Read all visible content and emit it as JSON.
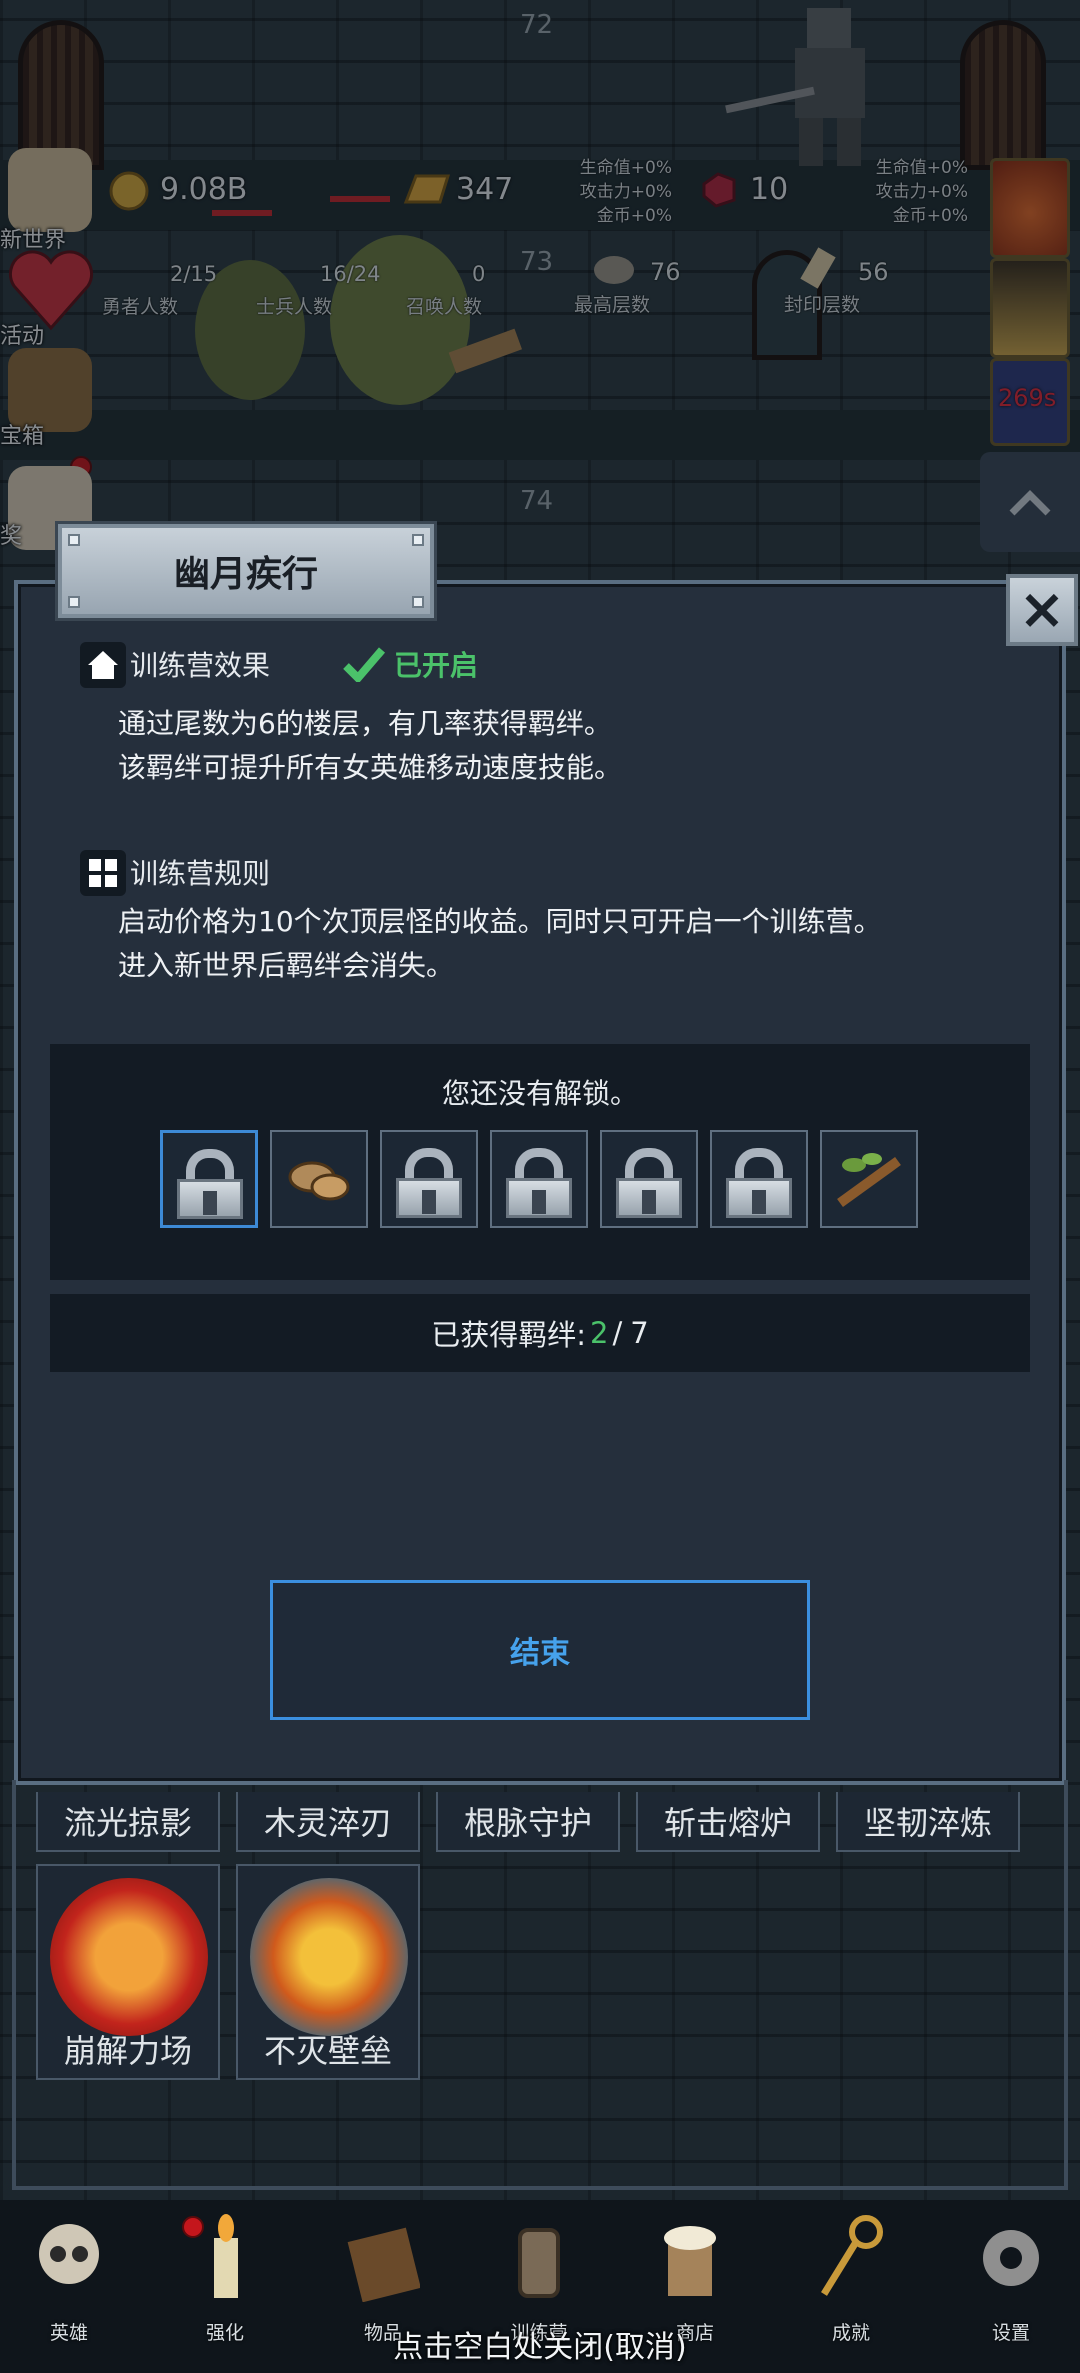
{
  "floors": [
    "72",
    "73",
    "74"
  ],
  "resources": {
    "gold": "9.08B",
    "bars": "347",
    "gems": "10",
    "buff_left": [
      "生命值+0%",
      "攻击力+0%",
      "金币+0%"
    ],
    "buff_right": [
      "生命值+0%",
      "攻击力+0%",
      "金币+0%"
    ]
  },
  "stats": [
    {
      "value": "2/15",
      "label": "勇者人数"
    },
    {
      "value": "16/24",
      "label": "士兵人数"
    },
    {
      "value": "0",
      "label": "召唤人数"
    },
    {
      "value": "76",
      "label": "最高层数"
    },
    {
      "value": "56",
      "label": "封印层数"
    }
  ],
  "side_menu": [
    "新世界",
    "活动",
    "宝箱",
    "奖"
  ],
  "timer": "269s",
  "dialog": {
    "title": "幽月疾行",
    "close_icon": "×",
    "effect_title": "训练营效果",
    "effect_status": "已开启",
    "effect_lines": [
      "通过尾数为6的楼层，有几率获得羁绊。",
      "该羁绊可提升所有女英雄移动速度技能。"
    ],
    "rules_title": "训练营规则",
    "rules_lines": [
      "启动价格为10个次顶层怪的收益。同时只可开启一个训练营。",
      "进入新世界后羁绊会消失。"
    ],
    "unlock_message": "您还没有解锁。",
    "bond_slots": [
      "locked",
      "mushroom",
      "locked",
      "locked",
      "locked",
      "locked",
      "branch"
    ],
    "count_label": "已获得羁绊:",
    "count_got": "2",
    "count_sep": "/",
    "count_total": "7",
    "end_button": "结束"
  },
  "skills_row": [
    "流光掠影",
    "木灵淬刃",
    "根脉守护",
    "斩击熔炉",
    "坚韧淬炼"
  ],
  "skill_cards": [
    "崩解力场",
    "不灭壁垒"
  ],
  "bottom_nav": [
    "英雄",
    "强化",
    "物品",
    "训练营",
    "商店",
    "成就",
    "设置"
  ],
  "close_hint": "点击空白处关闭(取消)",
  "colors": {
    "accent_blue": "#46a2ec",
    "green": "#4bc26a",
    "panel": "#252f3c"
  }
}
